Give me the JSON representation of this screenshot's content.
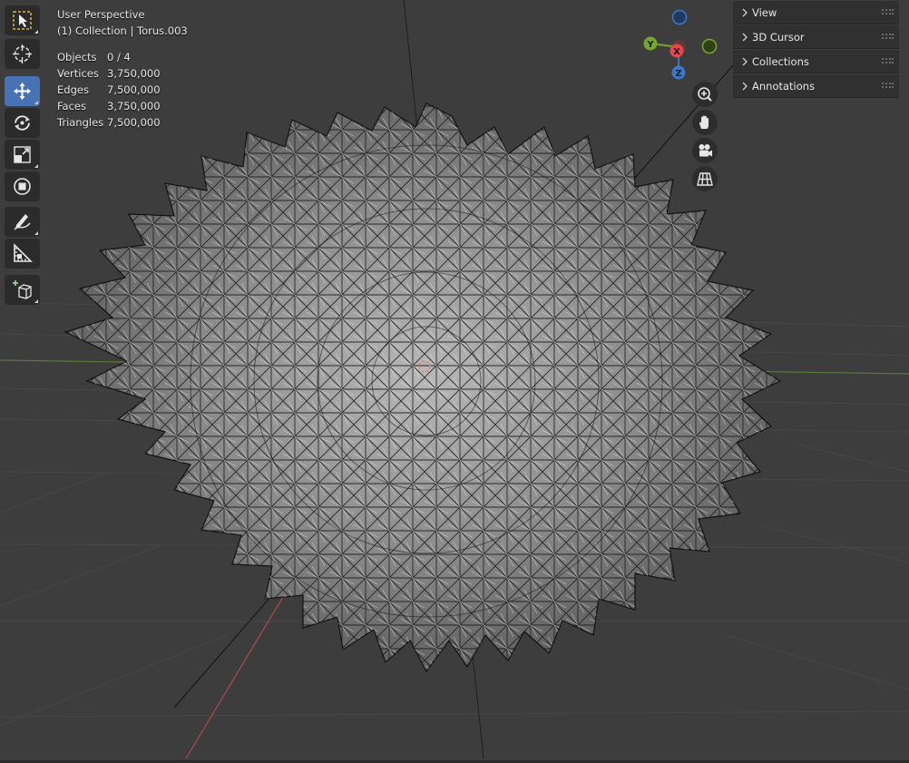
{
  "viewport": {
    "view_name": "User Perspective",
    "collection_name": "(1) Collection | Torus.003"
  },
  "stats": [
    {
      "label": "Objects",
      "value": "0 / 4"
    },
    {
      "label": "Vertices",
      "value": "3,750,000"
    },
    {
      "label": "Edges",
      "value": "7,500,000"
    },
    {
      "label": "Faces",
      "value": "3,750,000"
    },
    {
      "label": "Triangles",
      "value": "7,500,000"
    }
  ],
  "toolbar": [
    {
      "name": "select-box-tool",
      "icon": "select-box-icon",
      "active": false
    },
    {
      "name": "cursor-tool",
      "icon": "cursor-icon",
      "active": false
    },
    {
      "name": "move-tool",
      "icon": "move-icon",
      "active": true
    },
    {
      "name": "rotate-tool",
      "icon": "rotate-icon",
      "active": false
    },
    {
      "name": "scale-tool",
      "icon": "scale-icon",
      "active": false
    },
    {
      "name": "transform-tool",
      "icon": "transform-icon",
      "active": false
    },
    {
      "name": "annotate-tool",
      "icon": "annotate-icon",
      "active": false
    },
    {
      "name": "measure-tool",
      "icon": "measure-icon",
      "active": false
    },
    {
      "name": "add-cube-tool",
      "icon": "add-cube-icon",
      "active": false
    }
  ],
  "gizmo": {
    "x_label": "X",
    "y_label": "Y",
    "z_label": "Z",
    "x_color": "#e34850",
    "y_color": "#74a72b",
    "z_color": "#3a78c8"
  },
  "nav_buttons": [
    {
      "name": "zoom-button",
      "icon": "zoom-in-icon"
    },
    {
      "name": "pan-button",
      "icon": "hand-icon"
    },
    {
      "name": "camera-view-button",
      "icon": "camera-icon"
    },
    {
      "name": "ortho-toggle-button",
      "icon": "grid-icon"
    }
  ],
  "side_panel": {
    "items": [
      {
        "label": "View"
      },
      {
        "label": "3D Cursor"
      },
      {
        "label": "Collections"
      },
      {
        "label": "Annotations"
      }
    ]
  },
  "colors": {
    "background": "#3d3d3d",
    "active_tool": "#4772b3",
    "mesh_light": "#cfcfcf",
    "mesh_dark": "#1a1a1a"
  }
}
